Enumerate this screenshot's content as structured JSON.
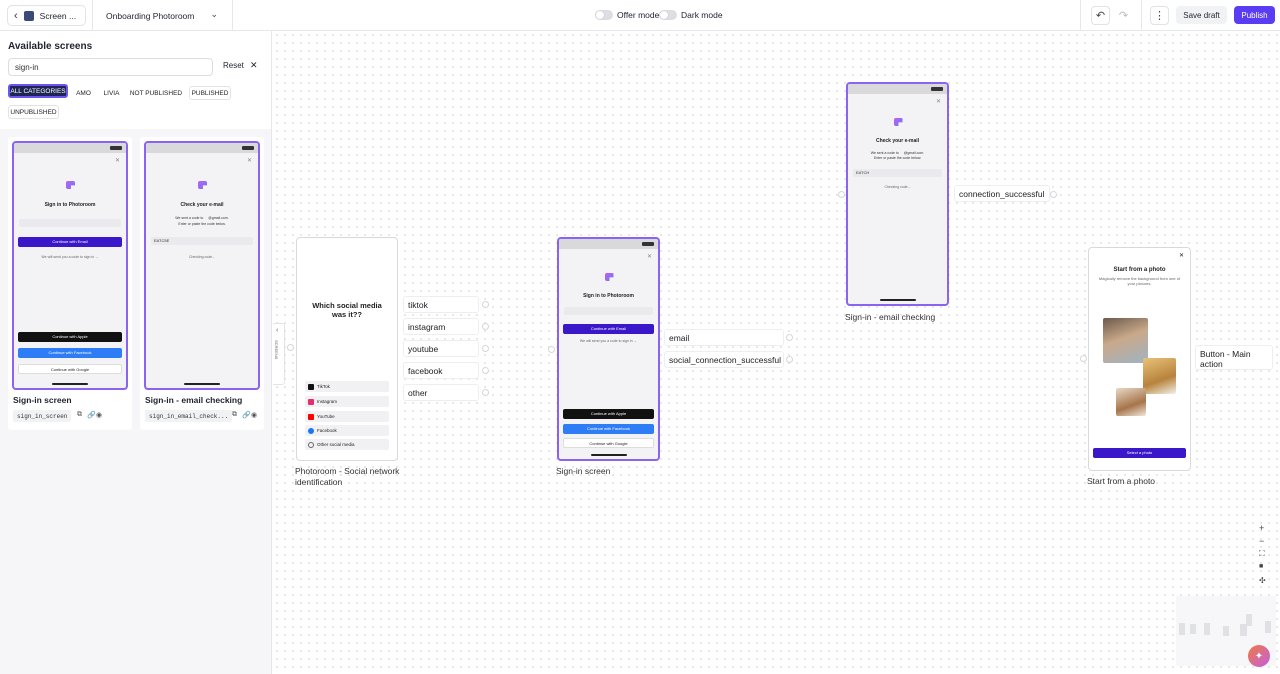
{
  "topbar": {
    "back_label": "Screen ...",
    "flow_name": "Onboarding Photoroom",
    "offer_mode_label": "Offer mode",
    "dark_mode_label": "Dark mode",
    "save_label": "Save draft",
    "publish_label": "Publish"
  },
  "panel": {
    "title": "Available screens",
    "search_value": "sign-in",
    "reset_label": "Reset",
    "categories": [
      "ALL CATEGORIES",
      "AMO",
      "LIVIA",
      "NOT PUBLISHED",
      "PUBLISHED",
      "UNPUBLISHED"
    ],
    "cards": [
      {
        "name": "Sign-in screen",
        "slug": "sign_in_screen"
      },
      {
        "name": "Sign-in - email checking",
        "slug": "sign_in_email_check..."
      }
    ]
  },
  "thumb_signin": {
    "title": "Sign in to Photoroom",
    "continue_email": "Continue with Email",
    "note": "We will send you a code to sign in →",
    "apple": "Continue with Apple",
    "facebook": "Continue with Facebook",
    "google": "Continue with Google"
  },
  "thumb_check": {
    "title": "Check your e-mail",
    "sent_a": "We sent a code to",
    "sent_b": "@gmail.com.",
    "enter": "Enter or paste the code below.",
    "code": "EATC5E",
    "code_canvas": "EATCH",
    "checking": "Checking code..."
  },
  "social_screen": {
    "title": "Which social media was it??",
    "options": [
      "TikTok",
      "Instagram",
      "YouTube",
      "Facebook",
      "Other social media"
    ]
  },
  "canvas": {
    "social_label": "Photoroom - Social network identification",
    "social_outputs": [
      "tiktok",
      "instagram",
      "youtube",
      "facebook",
      "other"
    ],
    "signin_label": "Sign-in screen",
    "signin_outputs": [
      "email",
      "social_connection_successful"
    ],
    "check_label": "Sign-in - email checking",
    "check_output": "connection_successful",
    "photo_label": "Start from a photo",
    "photo_output": "Button - Main action",
    "photo_title": "Start from a photo",
    "photo_sub": "Magically remove the background from one of your pictures.",
    "photo_btn": "Select a photo",
    "collapse_text": "SCREENS"
  },
  "colors": {
    "accent": "#5b3cf5",
    "phone_border": "#8a63f0",
    "chip_active": "#1e2554"
  }
}
